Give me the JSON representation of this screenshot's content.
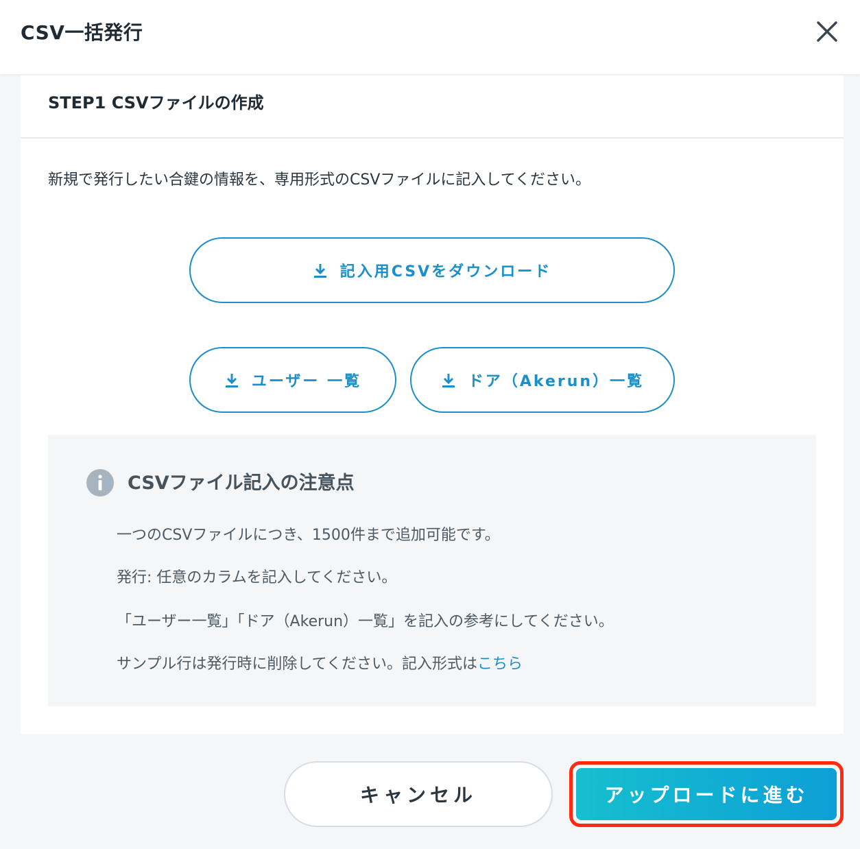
{
  "dialog": {
    "title": "CSV一括発行",
    "close_icon": "close-icon"
  },
  "step": {
    "title": "STEP1 CSVファイルの作成",
    "description": "新規で発行したい合鍵の情報を、専用形式のCSVファイルに記入してください。"
  },
  "downloads": {
    "csv_template_label": "記入用CSVをダウンロード",
    "users_label": "ユーザー 一覧",
    "doors_label": "ドア（Akerun）一覧",
    "icon": "download-icon"
  },
  "notice": {
    "icon": "info-icon",
    "title": "CSVファイル記入の注意点",
    "lines": [
      "一つのCSVファイルにつき、1500件まで追加可能です。",
      "発行: 任意のカラムを記入してください。",
      "「ユーザー一覧」「ドア（Akerun）一覧」を記入の参考にしてください。",
      "サンプル行は発行時に削除してください。記入形式は"
    ],
    "link_text": "こちら"
  },
  "footer": {
    "cancel_label": "キャンセル",
    "upload_label": "アップロードに進む"
  },
  "colors": {
    "accent": "#1a8fc8",
    "primary_gradient_start": "#16bfcf",
    "primary_gradient_end": "#0d9fd6",
    "highlight": "#ff2a12",
    "background": "#f4f6f8"
  }
}
